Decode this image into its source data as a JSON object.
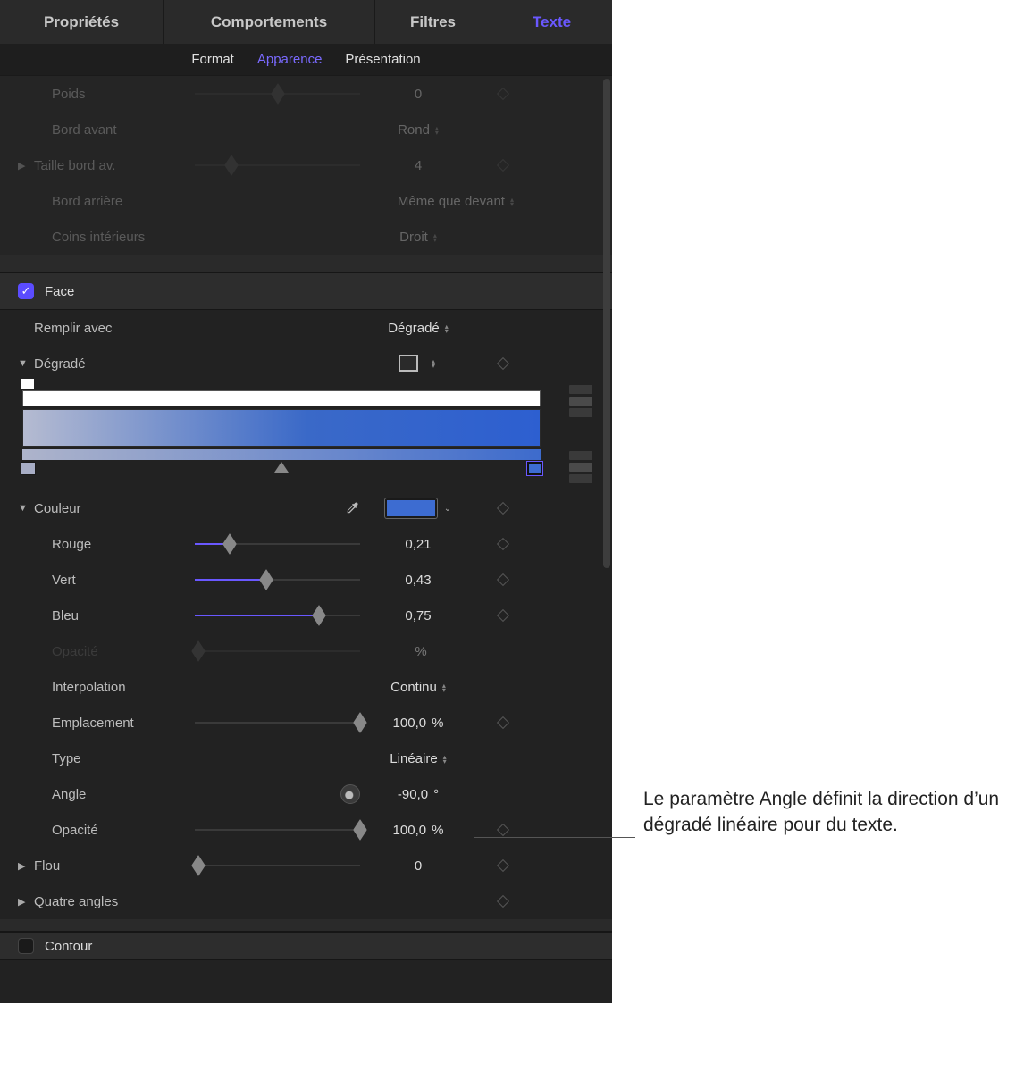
{
  "tabs": {
    "main": [
      "Propriétés",
      "Comportements",
      "Filtres",
      "Texte"
    ],
    "sub": [
      "Format",
      "Apparence",
      "Présentation"
    ]
  },
  "dim_rows": {
    "poids": {
      "label": "Poids",
      "value": "0"
    },
    "bord_avant": {
      "label": "Bord avant",
      "value": "Rond"
    },
    "taille_bord": {
      "label": "Taille bord av.",
      "value": "4"
    },
    "bord_arriere": {
      "label": "Bord arrière",
      "value": "Même que devant"
    },
    "coins": {
      "label": "Coins intérieurs",
      "value": "Droit"
    }
  },
  "face": {
    "title": "Face",
    "remplir_avec": {
      "label": "Remplir avec",
      "value": "Dégradé"
    },
    "degrade": {
      "label": "Dégradé"
    },
    "couleur": {
      "label": "Couleur"
    },
    "rouge": {
      "label": "Rouge",
      "value": "0,21"
    },
    "vert": {
      "label": "Vert",
      "value": "0,43"
    },
    "bleu": {
      "label": "Bleu",
      "value": "0,75"
    },
    "opacite1": {
      "label": "Opacité",
      "unit": "%"
    },
    "interpolation": {
      "label": "Interpolation",
      "value": "Continu"
    },
    "emplacement": {
      "label": "Emplacement",
      "value": "100,0",
      "unit": "%"
    },
    "type": {
      "label": "Type",
      "value": "Linéaire"
    },
    "angle": {
      "label": "Angle",
      "value": "-90,0",
      "unit": "°"
    },
    "opacite2": {
      "label": "Opacité",
      "value": "100,0",
      "unit": "%"
    },
    "flou": {
      "label": "Flou",
      "value": "0"
    },
    "quatre_angles": {
      "label": "Quatre angles"
    }
  },
  "contour": {
    "title": "Contour"
  },
  "callout": "Le paramètre Angle définit la direction d’un dégradé linéaire pour du texte."
}
